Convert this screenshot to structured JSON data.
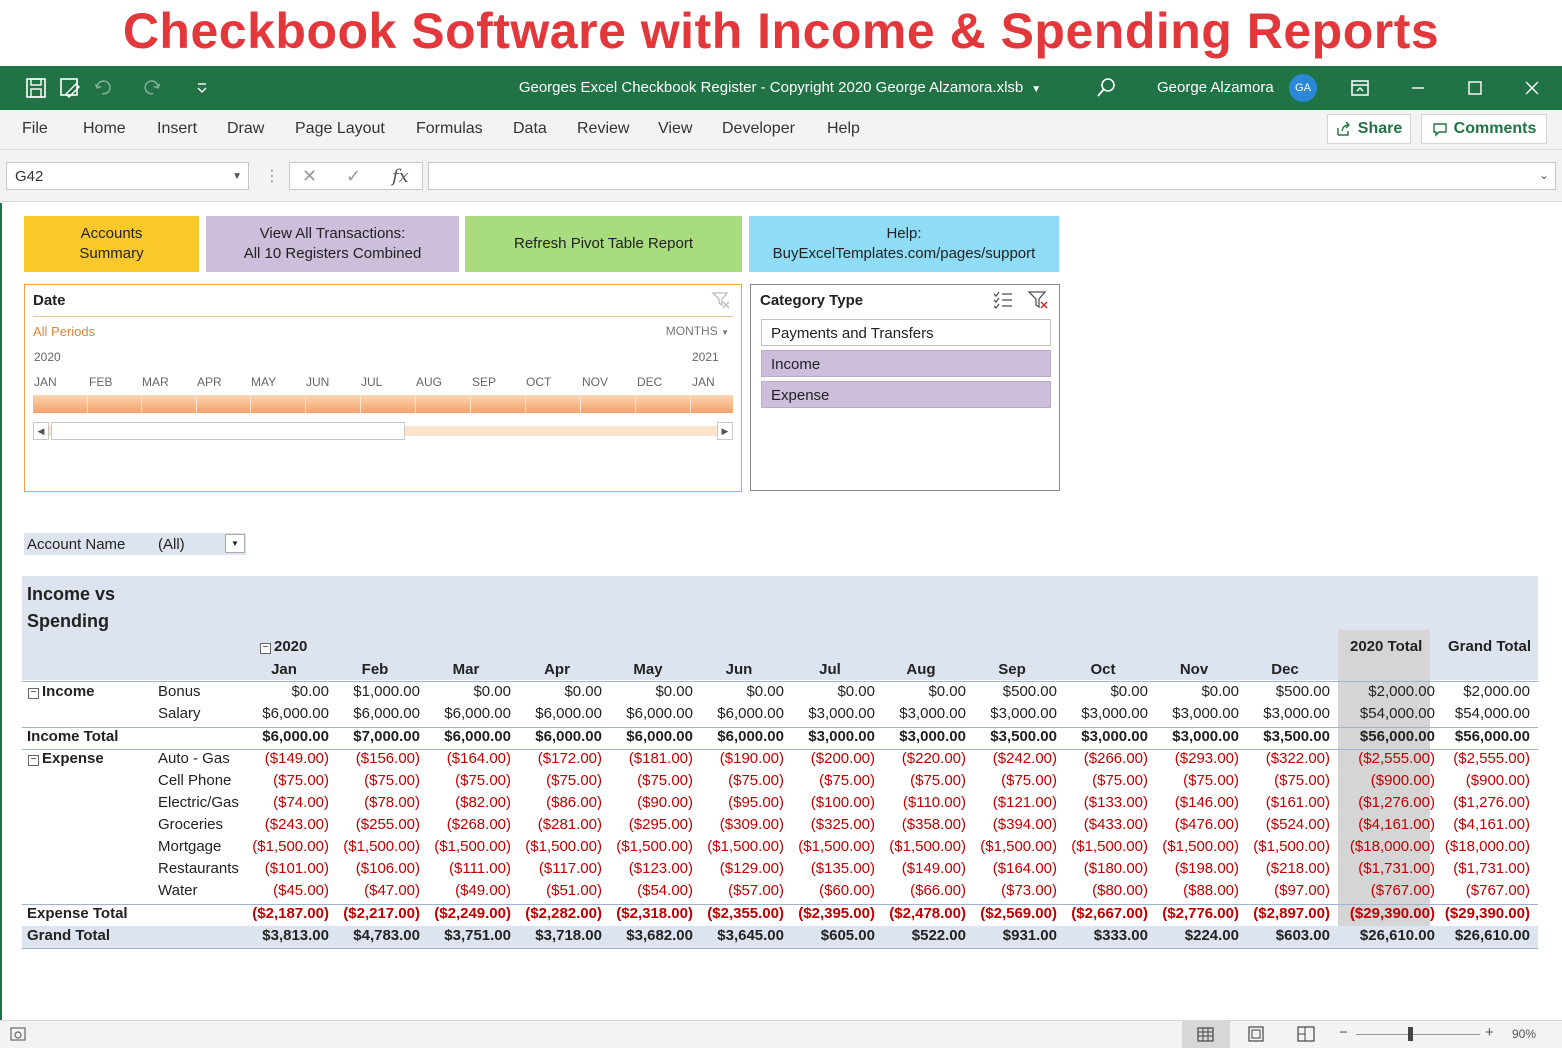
{
  "banner": "Checkbook Software with Income & Spending Reports",
  "window": {
    "title": "Georges Excel Checkbook Register -  Copyright 2020 George Alzamora.xlsb",
    "user": "George Alzamora",
    "avatar": "GA"
  },
  "ribbon": {
    "tabs": [
      "File",
      "Home",
      "Insert",
      "Draw",
      "Page Layout",
      "Formulas",
      "Data",
      "Review",
      "View",
      "Developer",
      "Help"
    ],
    "share": "Share",
    "comments": "Comments"
  },
  "formula_bar": {
    "name_box": "G42",
    "value": ""
  },
  "macro_buttons": {
    "accounts": [
      "Accounts",
      "Summary"
    ],
    "view_all": [
      "View All Transactions:",
      "All 10 Registers Combined"
    ],
    "refresh": "Refresh Pivot Table Report",
    "help": [
      "Help:",
      "BuyExcelTemplates.com/pages/support"
    ]
  },
  "date_slicer": {
    "title": "Date",
    "period_label": "All Periods",
    "level": "MONTHS",
    "year_start": "2020",
    "year_end": "2021",
    "months": [
      "JAN",
      "FEB",
      "MAR",
      "APR",
      "MAY",
      "JUN",
      "JUL",
      "AUG",
      "SEP",
      "OCT",
      "NOV",
      "DEC",
      "JAN"
    ]
  },
  "category_slicer": {
    "title": "Category Type",
    "items": [
      "Payments and Transfers",
      "Income",
      "Expense"
    ]
  },
  "filter": {
    "label": "Account Name",
    "value": "(All)"
  },
  "pivot": {
    "title": [
      "Income vs",
      "Spending"
    ],
    "year": "2020",
    "months": [
      "Jan",
      "Feb",
      "Mar",
      "Apr",
      "May",
      "Jun",
      "Jul",
      "Aug",
      "Sep",
      "Oct",
      "Nov",
      "Dec"
    ],
    "year_total": "2020 Total",
    "grand_total": "Grand Total",
    "income_group": "Income",
    "income_rows": [
      {
        "label": "Bonus",
        "values": [
          "$0.00",
          "$1,000.00",
          "$0.00",
          "$0.00",
          "$0.00",
          "$0.00",
          "$0.00",
          "$0.00",
          "$500.00",
          "$0.00",
          "$0.00",
          "$500.00",
          "$2,000.00",
          "$2,000.00"
        ]
      },
      {
        "label": "Salary",
        "values": [
          "$6,000.00",
          "$6,000.00",
          "$6,000.00",
          "$6,000.00",
          "$6,000.00",
          "$6,000.00",
          "$3,000.00",
          "$3,000.00",
          "$3,000.00",
          "$3,000.00",
          "$3,000.00",
          "$3,000.00",
          "$54,000.00",
          "$54,000.00"
        ]
      }
    ],
    "income_total": {
      "label": "Income Total",
      "values": [
        "$6,000.00",
        "$7,000.00",
        "$6,000.00",
        "$6,000.00",
        "$6,000.00",
        "$6,000.00",
        "$3,000.00",
        "$3,000.00",
        "$3,500.00",
        "$3,000.00",
        "$3,000.00",
        "$3,500.00",
        "$56,000.00",
        "$56,000.00"
      ]
    },
    "expense_group": "Expense",
    "expense_rows": [
      {
        "label": "Auto - Gas",
        "values": [
          "($149.00)",
          "($156.00)",
          "($164.00)",
          "($172.00)",
          "($181.00)",
          "($190.00)",
          "($200.00)",
          "($220.00)",
          "($242.00)",
          "($266.00)",
          "($293.00)",
          "($322.00)",
          "($2,555.00)",
          "($2,555.00)"
        ]
      },
      {
        "label": "Cell Phone",
        "values": [
          "($75.00)",
          "($75.00)",
          "($75.00)",
          "($75.00)",
          "($75.00)",
          "($75.00)",
          "($75.00)",
          "($75.00)",
          "($75.00)",
          "($75.00)",
          "($75.00)",
          "($75.00)",
          "($900.00)",
          "($900.00)"
        ]
      },
      {
        "label": "Electric/Gas",
        "values": [
          "($74.00)",
          "($78.00)",
          "($82.00)",
          "($86.00)",
          "($90.00)",
          "($95.00)",
          "($100.00)",
          "($110.00)",
          "($121.00)",
          "($133.00)",
          "($146.00)",
          "($161.00)",
          "($1,276.00)",
          "($1,276.00)"
        ]
      },
      {
        "label": "Groceries",
        "values": [
          "($243.00)",
          "($255.00)",
          "($268.00)",
          "($281.00)",
          "($295.00)",
          "($309.00)",
          "($325.00)",
          "($358.00)",
          "($394.00)",
          "($433.00)",
          "($476.00)",
          "($524.00)",
          "($4,161.00)",
          "($4,161.00)"
        ]
      },
      {
        "label": "Mortgage",
        "values": [
          "($1,500.00)",
          "($1,500.00)",
          "($1,500.00)",
          "($1,500.00)",
          "($1,500.00)",
          "($1,500.00)",
          "($1,500.00)",
          "($1,500.00)",
          "($1,500.00)",
          "($1,500.00)",
          "($1,500.00)",
          "($1,500.00)",
          "($18,000.00)",
          "($18,000.00)"
        ]
      },
      {
        "label": "Restaurants",
        "values": [
          "($101.00)",
          "($106.00)",
          "($111.00)",
          "($117.00)",
          "($123.00)",
          "($129.00)",
          "($135.00)",
          "($149.00)",
          "($164.00)",
          "($180.00)",
          "($198.00)",
          "($218.00)",
          "($1,731.00)",
          "($1,731.00)"
        ]
      },
      {
        "label": "Water",
        "values": [
          "($45.00)",
          "($47.00)",
          "($49.00)",
          "($51.00)",
          "($54.00)",
          "($57.00)",
          "($60.00)",
          "($66.00)",
          "($73.00)",
          "($80.00)",
          "($88.00)",
          "($97.00)",
          "($767.00)",
          "($767.00)"
        ]
      }
    ],
    "expense_total": {
      "label": "Expense Total",
      "values": [
        "($2,187.00)",
        "($2,217.00)",
        "($2,249.00)",
        "($2,282.00)",
        "($2,318.00)",
        "($2,355.00)",
        "($2,395.00)",
        "($2,478.00)",
        "($2,569.00)",
        "($2,667.00)",
        "($2,776.00)",
        "($2,897.00)",
        "($29,390.00)",
        "($29,390.00)"
      ]
    },
    "grand_total_row": {
      "label": "Grand Total",
      "values": [
        "$3,813.00",
        "$4,783.00",
        "$3,751.00",
        "$3,718.00",
        "$3,682.00",
        "$3,645.00",
        "$605.00",
        "$522.00",
        "$931.00",
        "$333.00",
        "$224.00",
        "$603.00",
        "$26,610.00",
        "$26,610.00"
      ]
    }
  },
  "status": {
    "zoom": "90%"
  },
  "colors": {
    "excel_green": "#217346",
    "banner_red": "#e3383b",
    "accounts_btn": "#f9c82b",
    "view_all_btn": "#cdbfdc",
    "refresh_btn": "#a8dc7e",
    "help_btn": "#8fdcf6",
    "negative": "#c00000"
  }
}
